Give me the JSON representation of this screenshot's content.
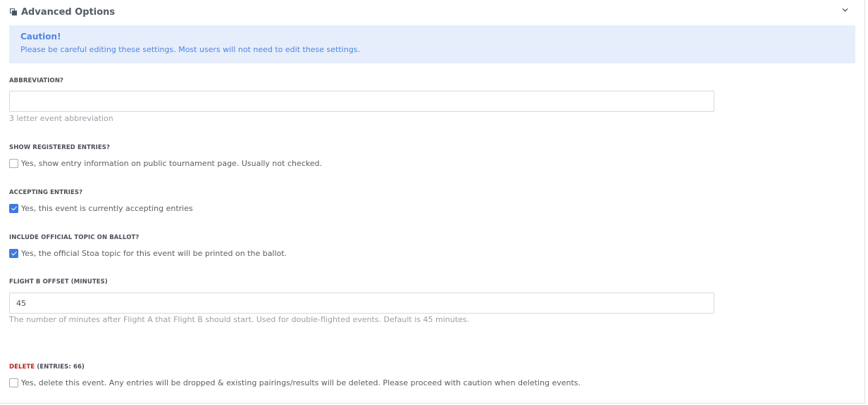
{
  "header": {
    "title": "Advanced Options",
    "icon": "clone-icon",
    "toggle_icon": "chevron-down-icon"
  },
  "alert": {
    "title": "Caution!",
    "text": "Please be careful editing these settings. Most users will not need to edit these settings."
  },
  "abbreviation": {
    "label": "ABBREVIATION?",
    "value": "",
    "help": "3 letter event abbreviation"
  },
  "show_registered": {
    "label": "SHOW REGISTERED ENTRIES?",
    "checkbox_label": "Yes, show entry information on public tournament page. Usually not checked.",
    "checked": false
  },
  "accepting": {
    "label": "ACCEPTING ENTRIES?",
    "checkbox_label": "Yes, this event is currently accepting entries",
    "checked": true
  },
  "official_topic": {
    "label": "INCLUDE OFFICIAL TOPIC ON BALLOT?",
    "checkbox_label": "Yes, the official Stoa topic for this event will be printed on the ballot.",
    "checked": true
  },
  "flight_offset": {
    "label": "FLIGHT B OFFSET (MINUTES)",
    "value": "45",
    "help": "The number of minutes after Flight A that Flight B should start. Used for double-flighted events. Default is 45 minutes."
  },
  "delete": {
    "label_red": "DELETE",
    "label_rest": " (ENTRIES: 66)",
    "checkbox_label": "Yes, delete this event. Any entries will be dropped & existing pairings/results will be deleted. Please proceed with caution when deleting events.",
    "checked": false
  },
  "colors": {
    "accent": "#3d7ae0",
    "alert_bg": "#e6edfb",
    "alert_text": "#4e86e2",
    "danger": "#b3261e"
  }
}
